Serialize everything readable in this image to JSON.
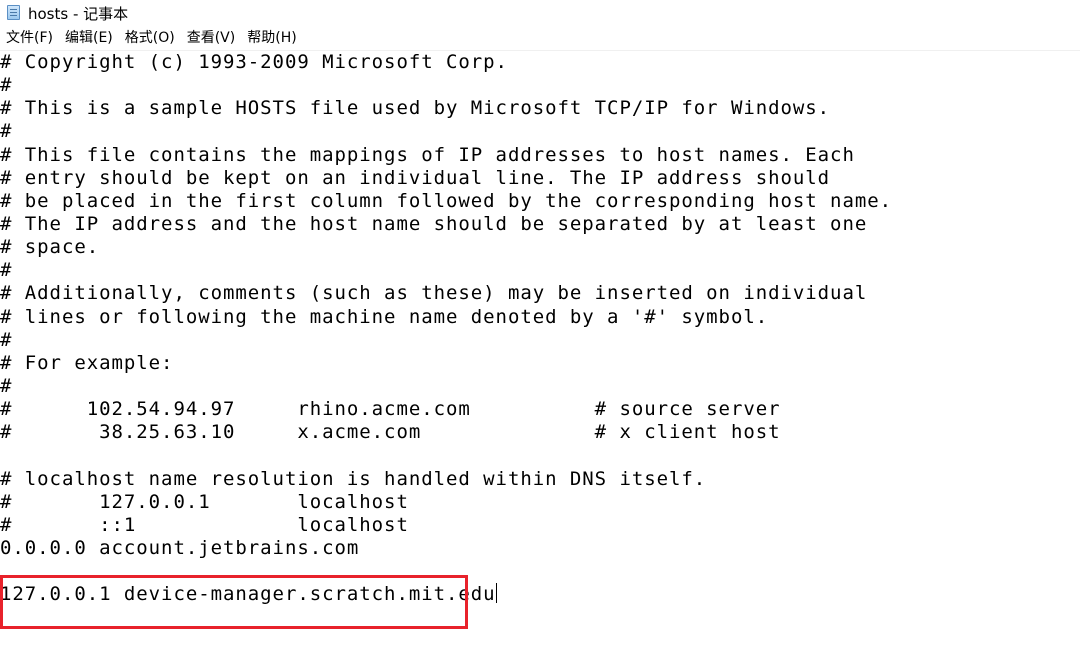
{
  "window": {
    "title": "hosts - 记事本"
  },
  "menu": {
    "items": [
      {
        "label": "文件(F)"
      },
      {
        "label": "编辑(E)"
      },
      {
        "label": "格式(O)"
      },
      {
        "label": "查看(V)"
      },
      {
        "label": "帮助(H)"
      }
    ]
  },
  "editor": {
    "lines": [
      "# Copyright (c) 1993-2009 Microsoft Corp.",
      "#",
      "# This is a sample HOSTS file used by Microsoft TCP/IP for Windows.",
      "#",
      "# This file contains the mappings of IP addresses to host names. Each",
      "# entry should be kept on an individual line. The IP address should",
      "# be placed in the first column followed by the corresponding host name.",
      "# The IP address and the host name should be separated by at least one",
      "# space.",
      "#",
      "# Additionally, comments (such as these) may be inserted on individual",
      "# lines or following the machine name denoted by a '#' symbol.",
      "#",
      "# For example:",
      "#",
      "#      102.54.94.97     rhino.acme.com          # source server",
      "#       38.25.63.10     x.acme.com              # x client host",
      "",
      "# localhost name resolution is handled within DNS itself.",
      "#       127.0.0.1       localhost",
      "#       ::1             localhost",
      "0.0.0.0 account.jetbrains.com",
      "",
      "127.0.0.1 device-manager.scratch.mit.edu"
    ]
  },
  "colors": {
    "highlight_border": "#e8222b",
    "text": "#000000",
    "background": "#ffffff"
  },
  "icons": {
    "app": "notepad-icon"
  }
}
